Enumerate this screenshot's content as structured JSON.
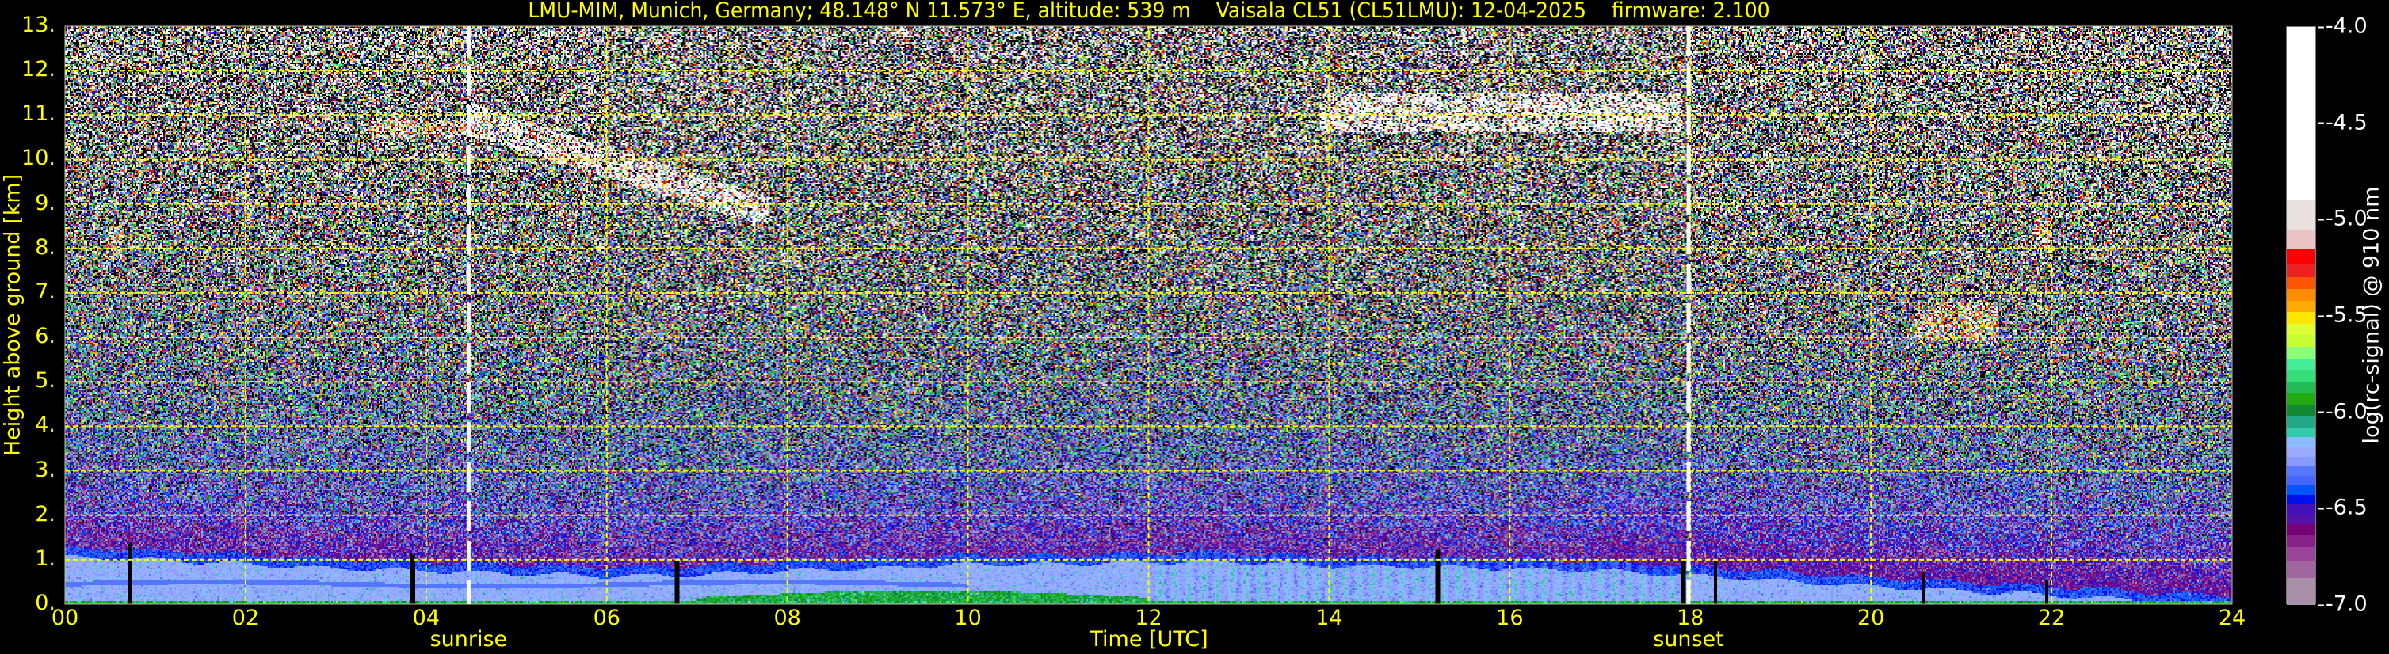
{
  "title": "LMU-MIM, Munich, Germany; 48.148° N 11.573° E, altitude: 539 m    Vaisala CL51 (CL51LMU): 12-04-2025    firmware: 2.100",
  "chart_data": {
    "type": "heatmap",
    "title": "LMU-MIM, Munich, Germany; 48.148° N 11.573° E, altitude: 539 m    Vaisala CL51 (CL51LMU): 12-04-2025    firmware: 2.100",
    "xlabel": "Time [UTC]",
    "ylabel": "Height above ground [km]",
    "xlim": [
      0,
      24
    ],
    "ylim": [
      0,
      13
    ],
    "xticks": [
      {
        "value": 0,
        "label": "00"
      },
      {
        "value": 2,
        "label": "02"
      },
      {
        "value": 4,
        "label": "04"
      },
      {
        "value": 6,
        "label": "06"
      },
      {
        "value": 8,
        "label": "08"
      },
      {
        "value": 10,
        "label": "10"
      },
      {
        "value": 12,
        "label": "12"
      },
      {
        "value": 14,
        "label": "14"
      },
      {
        "value": 16,
        "label": "16"
      },
      {
        "value": 18,
        "label": "18"
      },
      {
        "value": 20,
        "label": "20"
      },
      {
        "value": 22,
        "label": "22"
      },
      {
        "value": 24,
        "label": "24"
      }
    ],
    "yticks": [
      {
        "value": 0,
        "label": "0."
      },
      {
        "value": 1,
        "label": "1."
      },
      {
        "value": 2,
        "label": "2."
      },
      {
        "value": 3,
        "label": "3."
      },
      {
        "value": 4,
        "label": "4."
      },
      {
        "value": 5,
        "label": "5."
      },
      {
        "value": 6,
        "label": "6."
      },
      {
        "value": 7,
        "label": "7."
      },
      {
        "value": 8,
        "label": "8."
      },
      {
        "value": 9,
        "label": "9."
      },
      {
        "value": 10,
        "label": "10."
      },
      {
        "value": 11,
        "label": "11."
      },
      {
        "value": 12,
        "label": "12."
      },
      {
        "value": 13,
        "label": "13."
      }
    ],
    "grid": true,
    "grid_color": "#ffff00",
    "colorbar": {
      "label": "log(rc-signal) @ 910 nm",
      "clim": [
        -7.0,
        -4.0
      ],
      "ticks": [
        {
          "value": -4.0,
          "label": "-4.0"
        },
        {
          "value": -4.5,
          "label": "-4.5"
        },
        {
          "value": -5.0,
          "label": "-5.0"
        },
        {
          "value": -5.5,
          "label": "-5.5"
        },
        {
          "value": -6.0,
          "label": "-6.0"
        },
        {
          "value": -6.5,
          "label": "-6.5"
        },
        {
          "value": -7.0,
          "label": "-7.0"
        }
      ],
      "colors_high_to_low": [
        "#ffffff",
        "#ebe1e1",
        "#ecc3c3",
        "#ff0000",
        "#ee2222",
        "#ff5500",
        "#ff8c00",
        "#ffaa00",
        "#ffe600",
        "#ddff33",
        "#c6ff33",
        "#88ff77",
        "#44ee99",
        "#33dd77",
        "#22bb55",
        "#22aa11",
        "#118833",
        "#22aa88",
        "#33ccaa",
        "#88bbff",
        "#99aaff",
        "#8899ff",
        "#5577ff",
        "#4466ff",
        "#0055ff",
        "#0011ee",
        "#4411bb",
        "#5511aa",
        "#770077",
        "#882288",
        "#994499",
        "#a066a0",
        "#a890a8"
      ],
      "color_boundaries_high_to_low": [
        -4.0,
        -4.9,
        -5.05,
        -5.15,
        -5.23,
        -5.3,
        -5.36,
        -5.42,
        -5.48,
        -5.54,
        -5.6,
        -5.66,
        -5.72,
        -5.78,
        -5.84,
        -5.9,
        -5.96,
        -6.02,
        -6.08,
        -6.13,
        -6.18,
        -6.23,
        -6.28,
        -6.33,
        -6.38,
        -6.43,
        -6.48,
        -6.53,
        -6.58,
        -6.64,
        -6.7,
        -6.77,
        -6.86,
        -7.0
      ]
    },
    "annotations": [
      {
        "label": "sunrise",
        "x": 4.47
      },
      {
        "label": "sunset",
        "x": 17.98
      }
    ],
    "boundary_layer_top_km": {
      "time_h": [
        0,
        1,
        2,
        3,
        4,
        5,
        6,
        7,
        8,
        9,
        10,
        11,
        12,
        13,
        14,
        15,
        16,
        17,
        18,
        19,
        20,
        21,
        22,
        23,
        24
      ],
      "height_km": [
        1.25,
        1.2,
        1.1,
        1.0,
        0.95,
        0.88,
        0.83,
        0.85,
        0.95,
        1.0,
        1.1,
        1.1,
        1.15,
        1.15,
        1.05,
        1.05,
        1.0,
        0.95,
        0.85,
        0.72,
        0.6,
        0.5,
        0.4,
        0.28,
        0.18
      ]
    },
    "cloud_layers": [
      {
        "t_start": 0.45,
        "t_end": 0.65,
        "h_bottom": 7.7,
        "h_top": 8.5,
        "log_signal": -5.2
      },
      {
        "t_start": 3.4,
        "t_end": 4.5,
        "h_bottom": 10.5,
        "h_top": 10.9,
        "log_signal": -5.0
      },
      {
        "t_start": 4.5,
        "t_end": 7.8,
        "h_bottom": 8.8,
        "h_top": 10.9,
        "log_signal": -4.7
      },
      {
        "t_start": 13.9,
        "t_end": 17.9,
        "h_bottom": 10.6,
        "h_top": 11.5,
        "log_signal": -4.5
      },
      {
        "t_start": 20.5,
        "t_end": 21.4,
        "h_bottom": 5.9,
        "h_top": 6.8,
        "log_signal": -5.2
      },
      {
        "t_start": 21.8,
        "t_end": 22.0,
        "h_bottom": 8.0,
        "h_top": 8.7,
        "log_signal": -5.1
      }
    ],
    "surface_aerosol_layer": {
      "t_start": 7.0,
      "t_end": 12.0,
      "h_top": 0.3,
      "log_signal": -5.95
    },
    "data_gaps_h": [
      0.72,
      3.85,
      6.78,
      15.2,
      17.92,
      18.28,
      20.58,
      21.95
    ]
  }
}
